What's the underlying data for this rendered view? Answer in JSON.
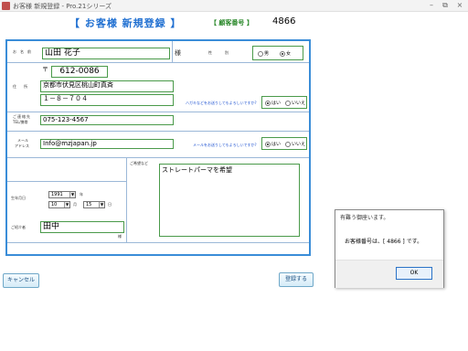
{
  "window": {
    "title": "お客様 新規登録 - Pro.21シリーズ",
    "icon": "app-icon",
    "controls": [
      "–",
      "⧉",
      "×"
    ]
  },
  "header": {
    "form_title": "【 お客様 新規登録 】",
    "customer_no_label": "【 顧客番号 】",
    "customer_no_value": "4866"
  },
  "form": {
    "name_label": "お名前",
    "name_value": "山田 花子",
    "honorific": "様",
    "gender_label": "性別",
    "gender_options": [
      "男",
      "女"
    ],
    "gender_selected": "女",
    "postal_mark": "〒",
    "postal_value": "612-0086",
    "address_label": "住所",
    "address_line1": "京都市伏見区桃山町真斉",
    "address_line2": "１－８－７０４",
    "dm_question": "ハガキなどをお送りしてもよろしいですか?",
    "yes_label": "はい",
    "no_label": "いいえ",
    "dm_selected": "はい",
    "phone_label_1": "ご連絡先",
    "phone_label_2": "TEL/携帯",
    "phone_value": "075-123-4567",
    "email_label_1": "メール",
    "email_label_2": "アドレス",
    "email_value": "Info@mzjapan.jp",
    "mail_question": "メールをお送りしてもよろしいですか?",
    "mail_selected": "はい",
    "request_label": "ご希望など",
    "request_value": "ストレートパーマを希望",
    "birth_label": "生年月日",
    "birth_year": "1991",
    "birth_year_unit": "年",
    "birth_month": "10",
    "birth_month_unit": "月",
    "birth_day": "15",
    "birth_day_unit": "日",
    "referrer_label": "ご紹介者",
    "referrer_value": "田中",
    "referrer_honorific": "様"
  },
  "buttons": {
    "cancel": "キャンセル",
    "register": "登録する"
  },
  "dialog": {
    "title": "有難う御座います。",
    "message": "お客様番号は、[ 4866 ] です。",
    "ok": "OK"
  },
  "colors": {
    "panel_border": "#3a8dd8",
    "title_blue": "#1f6fd1",
    "label_green": "#2d8a2d",
    "field_border": "#4a9a4a"
  }
}
